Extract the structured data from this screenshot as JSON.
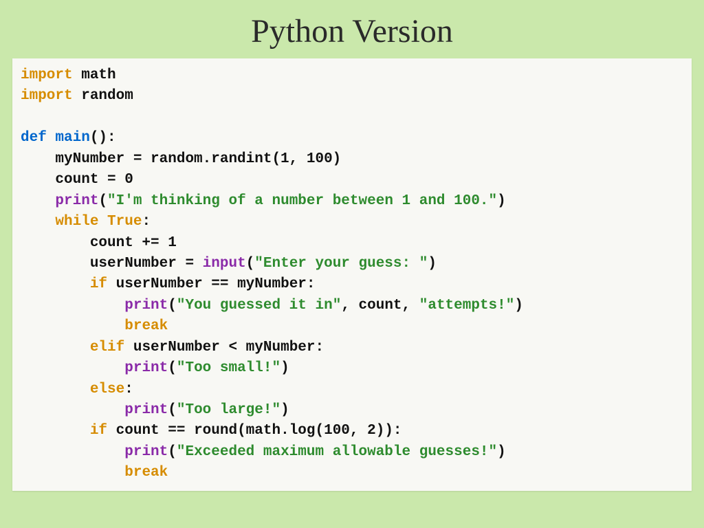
{
  "slide": {
    "title": "Python Version"
  },
  "code": {
    "tokens": {
      "import1": "import",
      "math": " math",
      "import2": "import",
      "random": " random",
      "def": "def",
      "main": " main",
      "main_sig": "():",
      "l1": "    myNumber = random.randint(1, 100)",
      "l2": "    count = 0",
      "print1_kw": "print",
      "print1_arg": "(",
      "print1_str": "\"I'm thinking of a number between 1 and 100.\"",
      "print1_close": ")",
      "while_kw": "while",
      "true_kw": " True",
      "while_colon": ":",
      "l3": "        count += 1",
      "input_lhs": "        userNumber = ",
      "input_kw": "input",
      "input_open": "(",
      "input_str": "\"Enter your guess: \"",
      "input_close": ")",
      "if1_kw": "if",
      "if1_cond": " userNumber == myNumber:",
      "print2_indent": "            ",
      "print2_kw": "print",
      "print2_open": "(",
      "print2_str1": "\"You guessed it in\"",
      "print2_mid": ", count, ",
      "print2_str2": "\"attempts!\"",
      "print2_close": ")",
      "break1_indent": "            ",
      "break1": "break",
      "elif_indent": "        ",
      "elif_kw": "elif",
      "elif_cond": " userNumber < myNumber:",
      "print3_indent": "            ",
      "print3_kw": "print",
      "print3_open": "(",
      "print3_str": "\"Too small!\"",
      "print3_close": ")",
      "else_indent": "        ",
      "else_kw": "else",
      "else_colon": ":",
      "print4_indent": "            ",
      "print4_kw": "print",
      "print4_open": "(",
      "print4_str": "\"Too large!\"",
      "print4_close": ")",
      "if2_indent": "        ",
      "if2_kw": "if",
      "if2_cond": " count == round(math.log(100, 2)):",
      "print5_indent": "            ",
      "print5_kw": "print",
      "print5_open": "(",
      "print5_str": "\"Exceeded maximum allowable guesses!\"",
      "print5_close": ")",
      "break2_indent": "            ",
      "break2": "break"
    }
  }
}
